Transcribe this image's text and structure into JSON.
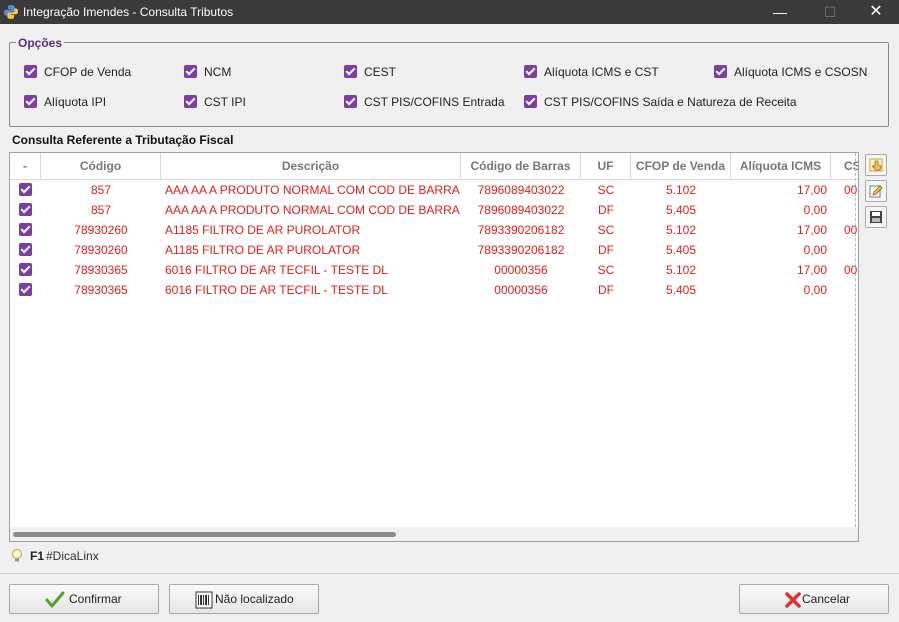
{
  "window": {
    "title": "Integração Imendes - Consulta Tributos",
    "controls": {
      "minimize": "—",
      "maximize": "☐",
      "close": "✕"
    }
  },
  "options": {
    "legend": "Opções",
    "items": [
      {
        "label": "CFOP de Venda",
        "checked": true
      },
      {
        "label": "NCM",
        "checked": true
      },
      {
        "label": "CEST",
        "checked": true
      },
      {
        "label": "Alíquota ICMS e CST",
        "checked": true
      },
      {
        "label": "Alíquota ICMS e CSOSN",
        "checked": true
      },
      {
        "label": "Alíquota IPI",
        "checked": true
      },
      {
        "label": "CST IPI",
        "checked": true
      },
      {
        "label": "CST PIS/COFINS Entrada",
        "checked": true
      },
      {
        "label": "CST PIS/COFINS Saída e Natureza de Receita",
        "checked": true
      }
    ]
  },
  "grid": {
    "title": "Consulta Referente a Tributação Fiscal",
    "columns": [
      "-",
      "Código",
      "Descrição",
      "Código de Barras",
      "UF",
      "CFOP de Venda",
      "Alíquota ICMS",
      "CS"
    ],
    "rows": [
      {
        "checked": true,
        "codigo": "857",
        "descricao": "AAA AA A PRODUTO NORMAL COM COD DE BARRA - L",
        "barras": "7896089403022",
        "uf": "SC",
        "cfop": "5.102",
        "aliquota": "17,00",
        "cs": "00"
      },
      {
        "checked": true,
        "codigo": "857",
        "descricao": "AAA AA A PRODUTO NORMAL COM COD DE BARRA - L",
        "barras": "7896089403022",
        "uf": "DF",
        "cfop": "5.405",
        "aliquota": "0,00",
        "cs": ""
      },
      {
        "checked": true,
        "codigo": "78930260",
        "descricao": "A1185 FILTRO DE AR PUROLATOR",
        "barras": "7893390206182",
        "uf": "SC",
        "cfop": "5.102",
        "aliquota": "17,00",
        "cs": "00"
      },
      {
        "checked": true,
        "codigo": "78930260",
        "descricao": "A1185 FILTRO DE AR PUROLATOR",
        "barras": "7893390206182",
        "uf": "DF",
        "cfop": "5.405",
        "aliquota": "0,00",
        "cs": ""
      },
      {
        "checked": true,
        "codigo": "78930365",
        "descricao": "6016 FILTRO DE AR TECFIL - TESTE DL",
        "barras": "00000356",
        "uf": "SC",
        "cfop": "5.102",
        "aliquota": "17,00",
        "cs": "00"
      },
      {
        "checked": true,
        "codigo": "78930365",
        "descricao": "6016 FILTRO DE AR TECFIL - TESTE DL",
        "barras": "00000356",
        "uf": "DF",
        "cfop": "5.405",
        "aliquota": "0,00",
        "cs": ""
      }
    ],
    "row_text_color": "#e0201c"
  },
  "tools": [
    {
      "icon": "hand-pointer-icon"
    },
    {
      "icon": "edit-icon"
    },
    {
      "icon": "save-icon"
    }
  ],
  "hint": {
    "key": "F1",
    "text": "#DicaLinx"
  },
  "buttons": {
    "confirm": "Confirmar",
    "not_found": "Não localizado",
    "cancel": "Cancelar"
  },
  "colors": {
    "accent": "#7b3fa3",
    "legend": "#5d2a86",
    "titlebar": "#3a3a3a"
  }
}
